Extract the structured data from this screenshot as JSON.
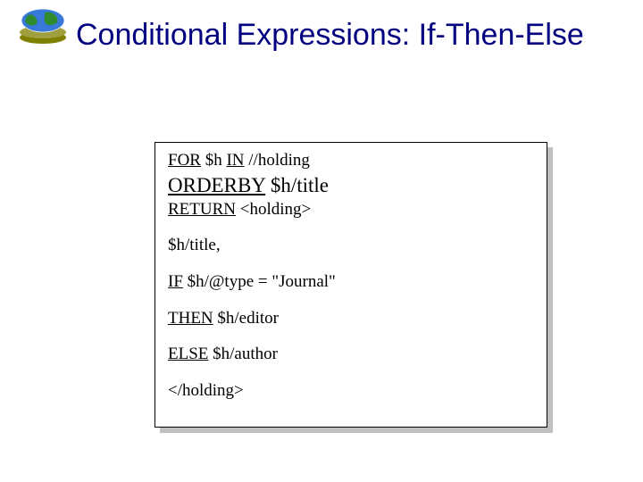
{
  "title": "Conditional Expressions: If-Then-Else",
  "code": {
    "line1": {
      "kw_for": "FOR",
      "var1": " $h ",
      "kw_in": "IN",
      "rest": " //holding"
    },
    "line2": {
      "kw_orderby": "ORDERBY",
      "rest": " $h/title"
    },
    "line3": {
      "kw_return": "RETURN",
      "rest": " <holding>"
    },
    "line4": "$h/title,",
    "line5": {
      "kw_if": "IF",
      "rest": " $h/@type = \"Journal\""
    },
    "line6": {
      "kw_then": "THEN",
      "rest": " $h/editor"
    },
    "line7": {
      "kw_else": "ELSE",
      "rest": " $h/author"
    },
    "line8": "</holding>"
  }
}
